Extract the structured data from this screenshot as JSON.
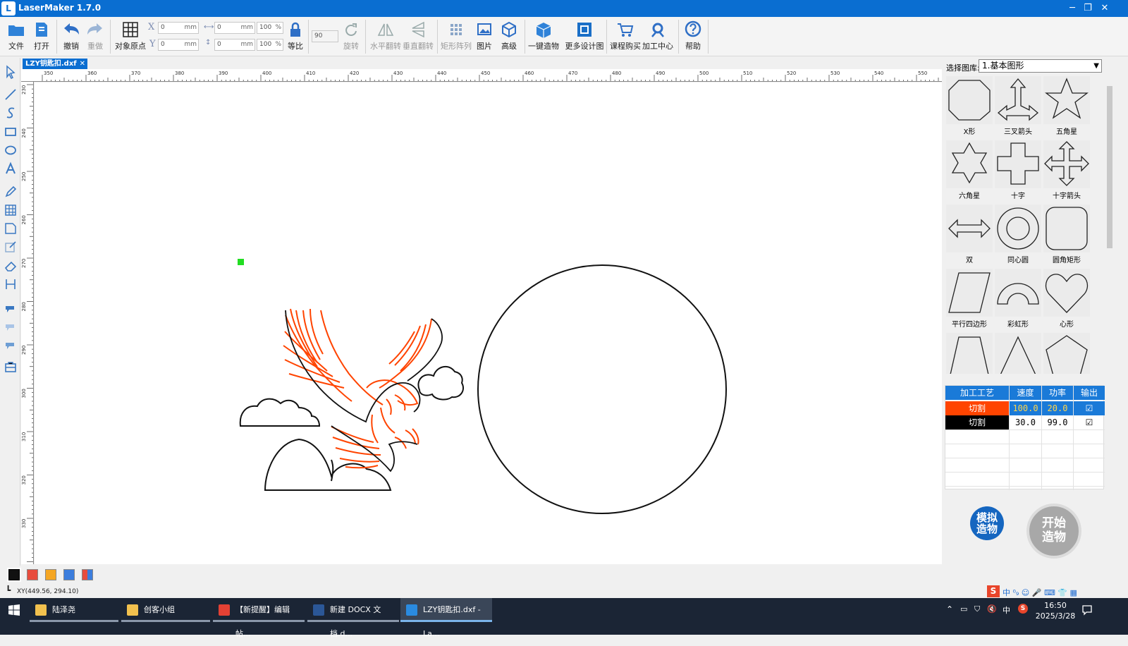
{
  "window": {
    "title": "LaserMaker 1.7.0",
    "app_icon": "L",
    "min": "─",
    "restore": "❐",
    "close": "✕"
  },
  "toolbar": {
    "file": "文件",
    "open": "打开",
    "undo": "撤销",
    "redo": "重做",
    "origin": "对象原点",
    "x_label": "X",
    "y_label": "Y",
    "x_value": "0",
    "y_value": "0",
    "unit": "mm",
    "w_value": "0",
    "h_value": "0",
    "w_pct": "100",
    "h_pct": "100",
    "pct_unit": "%",
    "ratio": "等比",
    "angle": "90",
    "rotate": "旋转",
    "hflip": "水平翻转",
    "vflip": "垂直翻转",
    "array": "矩形阵列",
    "image": "图片",
    "advanced": "高级",
    "oneclick": "一键造物",
    "more": "更多设计图",
    "course": "课程购买",
    "center": "加工中心",
    "help": "帮助"
  },
  "doc_tab": {
    "name": "LZY钥匙扣.dxf",
    "close": "✕"
  },
  "ruler": {
    "h_ticks": [
      "350",
      "360",
      "370",
      "380",
      "390",
      "400",
      "410",
      "420",
      "430",
      "440",
      "450",
      "460",
      "470",
      "480",
      "490",
      "500",
      "510",
      "520",
      "530",
      "540",
      "550"
    ],
    "v_ticks": [
      "230",
      "240",
      "250",
      "260",
      "270",
      "280",
      "290",
      "300",
      "310",
      "320",
      "330"
    ]
  },
  "library": {
    "label": "选择图库:",
    "selected": "1.基本图形",
    "arrow": "▼",
    "shapes": [
      {
        "name": "X形"
      },
      {
        "name": "三叉箭头"
      },
      {
        "name": "五角星"
      },
      {
        "name": "六角星"
      },
      {
        "name": "十字"
      },
      {
        "name": "十字箭头"
      },
      {
        "name": "双"
      },
      {
        "name": "同心圆"
      },
      {
        "name": "圆角矩形"
      },
      {
        "name": "平行四边形"
      },
      {
        "name": "彩虹形"
      },
      {
        "name": "心形"
      },
      {
        "name": ""
      },
      {
        "name": ""
      },
      {
        "name": ""
      }
    ]
  },
  "process": {
    "headers": [
      "加工工艺",
      "速度",
      "功率",
      "输出"
    ],
    "rows": [
      {
        "mode": "切割",
        "speed": "100.0",
        "power": "20.0",
        "output": "☑",
        "color": "#ff4400"
      },
      {
        "mode": "切割",
        "speed": "30.0",
        "power": "99.0",
        "output": "☑",
        "color": "#000000"
      }
    ]
  },
  "buttons": {
    "simulate": "模拟造物",
    "start": "开始造物"
  },
  "swatches": [
    "#111111",
    "#e84c3d",
    "#f5a623",
    "#3b7ddd",
    "multi"
  ],
  "status": {
    "xy": "XY(449.56, 294.10)"
  },
  "ime": "中 ⁰₉ ☺ 🎤 ⌨ 👕 ▦",
  "taskbar": {
    "items": [
      {
        "label": "陆泽尧",
        "icon_color": "#f2c14e"
      },
      {
        "label": "创客小组",
        "icon_color": "#f2c14e"
      },
      {
        "label": "【新提醒】编辑帖...",
        "icon_color": "#e44134"
      },
      {
        "label": "新建 DOCX 文档.d...",
        "icon_color": "#2b5797"
      },
      {
        "label": "LZY钥匙扣.dxf - La...",
        "icon_color": "#2a8be0"
      }
    ],
    "tray": "中",
    "time": "16:50",
    "date": "2025/3/28"
  }
}
